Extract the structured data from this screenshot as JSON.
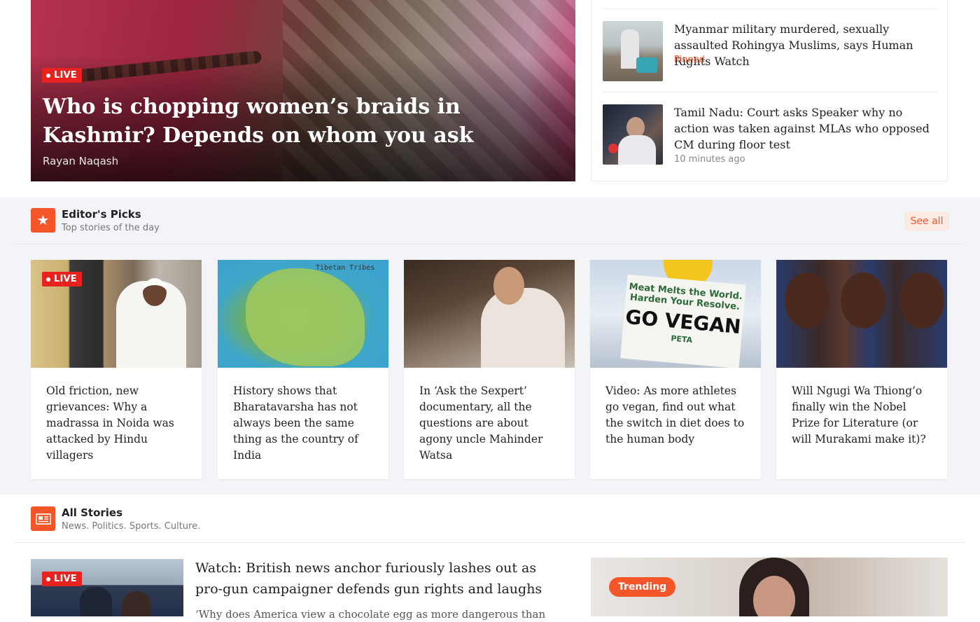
{
  "hero": {
    "badge": "LIVE",
    "title": "Who is chopping women’s braids in Kashmir? Depends on whom you ask",
    "author": "Rayan Naqash"
  },
  "side_stories": [
    {
      "title": "Myanmar military murdered, sexually assaulted Rohingya Muslims, says Human Rights Watch",
      "meta": "Pinned",
      "meta_color": "#f4562a"
    },
    {
      "title": "Tamil Nadu: Court asks Speaker why no action was taken against MLAs who opposed CM during floor test",
      "meta": "10 minutes ago",
      "meta_color": "#888888"
    }
  ],
  "editors_picks": {
    "title": "Editor's Picks",
    "subtitle": "Top stories of the day",
    "see_all": "See all",
    "icon": "star-icon",
    "cards": [
      {
        "badge": "LIVE",
        "title": "Old friction, new grievances: Why a madrassa in Noida was attacked by Hindu villagers"
      },
      {
        "badge": "",
        "title": "History shows that Bharatavarsha has not always been the same thing as the country of India",
        "image_text": "Tibetan Tribes"
      },
      {
        "badge": "",
        "title": "In ‘Ask the Sexpert’ documentary, all the questions are about agony uncle Mahinder Watsa"
      },
      {
        "badge": "",
        "title": "Video: As more athletes go vegan, find out what the switch in diet does to the human body",
        "image_text": [
          "Meat Melts the World.",
          "Harden Your Resolve.",
          "GO VEGAN",
          "PETA"
        ]
      },
      {
        "badge": "",
        "title": "Will Ngugi Wa Thiong’o finally win the Nobel Prize for Literature (or will Murakami make it)?"
      }
    ]
  },
  "all_stories": {
    "title": "All Stories",
    "subtitle": "News. Politics. Sports. Culture.",
    "icon": "newspaper-icon",
    "lead": {
      "badge": "LIVE",
      "title": "Watch: British news anchor furiously lashes out as pro-gun campaigner defends gun rights and laughs",
      "excerpt": "‘Why does America view a chocolate egg as more dangerous than"
    },
    "trending": "Trending"
  },
  "colors": {
    "accent": "#f4562a",
    "live": "#e8231f"
  }
}
